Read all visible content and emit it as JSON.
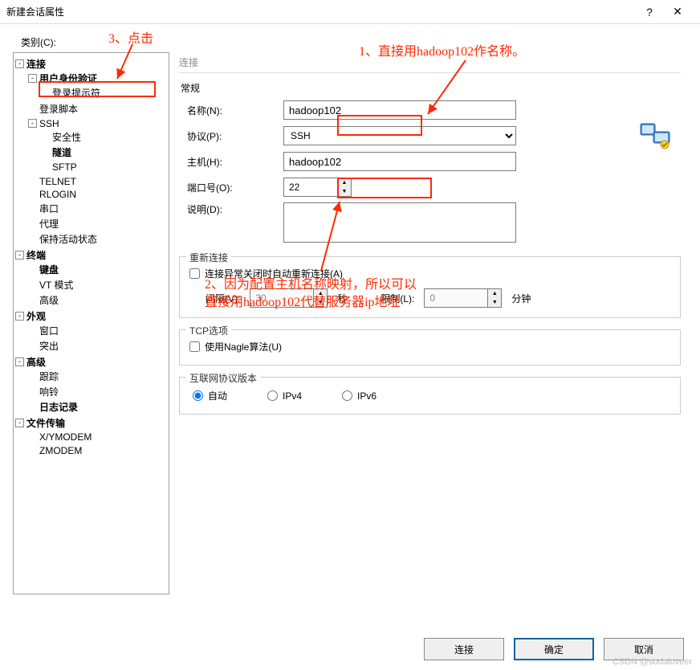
{
  "window": {
    "title": "新建会话属性",
    "help": "?",
    "close": "✕"
  },
  "category_label": "类别(C):",
  "tree": {
    "connection": "连接",
    "user_auth": "用户身份验证",
    "login_prompt": "登录提示符",
    "login_script": "登录脚本",
    "ssh": "SSH",
    "security": "安全性",
    "tunnel": "隧道",
    "sftp": "SFTP",
    "telnet": "TELNET",
    "rlogin": "RLOGIN",
    "serial": "串口",
    "proxy": "代理",
    "keepalive": "保持活动状态",
    "terminal": "终端",
    "keyboard": "键盘",
    "vt": "VT 模式",
    "adv1": "高级",
    "appearance": "外观",
    "window": "窗口",
    "highlight": "突出",
    "advanced": "高级",
    "trace": "跟踪",
    "bell": "响铃",
    "log": "日志记录",
    "filetransfer": "文件传输",
    "xymodem": "X/YMODEM",
    "zmodem": "ZMODEM"
  },
  "panel": {
    "section": "连接",
    "group_general": "常规",
    "name_label": "名称(N):",
    "name_value": "hadoop102",
    "proto_label": "协议(P):",
    "proto_value": "SSH",
    "host_label": "主机(H):",
    "host_value": "hadoop102",
    "port_label": "端口号(O):",
    "port_value": "22",
    "desc_label": "说明(D):",
    "desc_value": "",
    "group_reconnect": "重新连接",
    "reconnect_chk": "连接异常关闭时自动重新连接(A)",
    "interval_label": "间隔(V):",
    "interval_value": "30",
    "interval_unit": "秒",
    "limit_label": "限制(L):",
    "limit_value": "0",
    "limit_unit": "分钟",
    "group_tcp": "TCP选项",
    "nagle_chk": "使用Nagle算法(U)",
    "group_ipver": "互联网协议版本",
    "ip_auto": "自动",
    "ip_v4": "IPv4",
    "ip_v6": "IPv6"
  },
  "footer": {
    "connect": "连接",
    "ok": "确定",
    "cancel": "取消"
  },
  "annotations": {
    "a1": "1、直接用hadoop102作名称。",
    "a2a": "2、因为配置主机名称映射，所以可以",
    "a2b": "直接用hadoop102代替服务器ip地址",
    "a3": "3、点击"
  },
  "watermark": "CSDN @sodaloveer"
}
